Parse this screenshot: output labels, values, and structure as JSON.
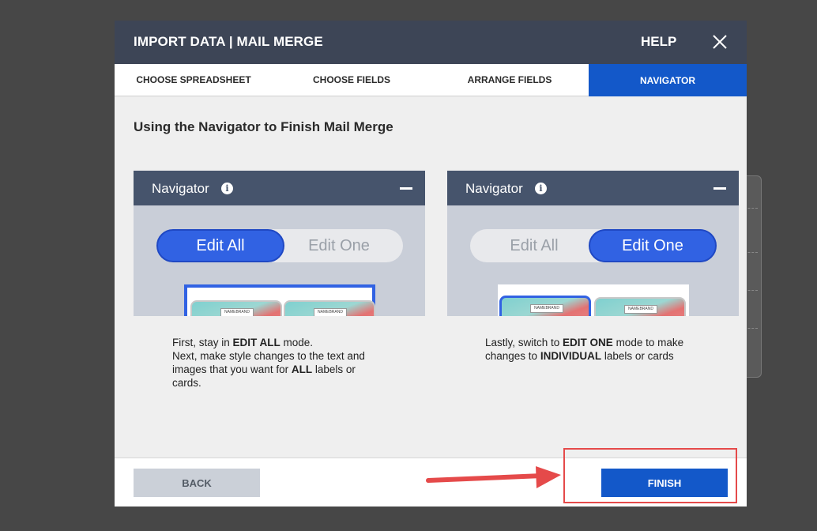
{
  "modal": {
    "title": "IMPORT DATA | MAIL MERGE",
    "help_label": "HELP"
  },
  "tabs": [
    {
      "label": "CHOOSE SPREADSHEET"
    },
    {
      "label": "CHOOSE FIELDS"
    },
    {
      "label": "ARRANGE FIELDS"
    },
    {
      "label": "NAVIGATOR",
      "active": true
    }
  ],
  "heading": "Using the Navigator to Finish Mail Merge",
  "cards": [
    {
      "title": "Navigator",
      "toggle": {
        "left": "Edit All",
        "right": "Edit One",
        "active": "left"
      },
      "preview_brand": "NAMEBRAND",
      "desc_parts": [
        "First, stay in ",
        "EDIT ALL",
        " mode.",
        "Next, make style changes to the text and images that you want for ",
        "ALL",
        " labels or cards."
      ]
    },
    {
      "title": "Navigator",
      "toggle": {
        "left": "Edit All",
        "right": "Edit One",
        "active": "right"
      },
      "preview_brand": "NAMEBRAND",
      "desc_parts": [
        "Lastly, switch to ",
        "EDIT ONE",
        " mode to make changes to ",
        "INDIVIDUAL",
        " labels or cards"
      ]
    }
  ],
  "footer": {
    "back_label": "BACK",
    "finish_label": "FINISH"
  },
  "colors": {
    "header_bg": "#3d4556",
    "accent": "#1358c9",
    "toggle_active": "#3162e3",
    "annotation_red": "#e54a4a"
  }
}
